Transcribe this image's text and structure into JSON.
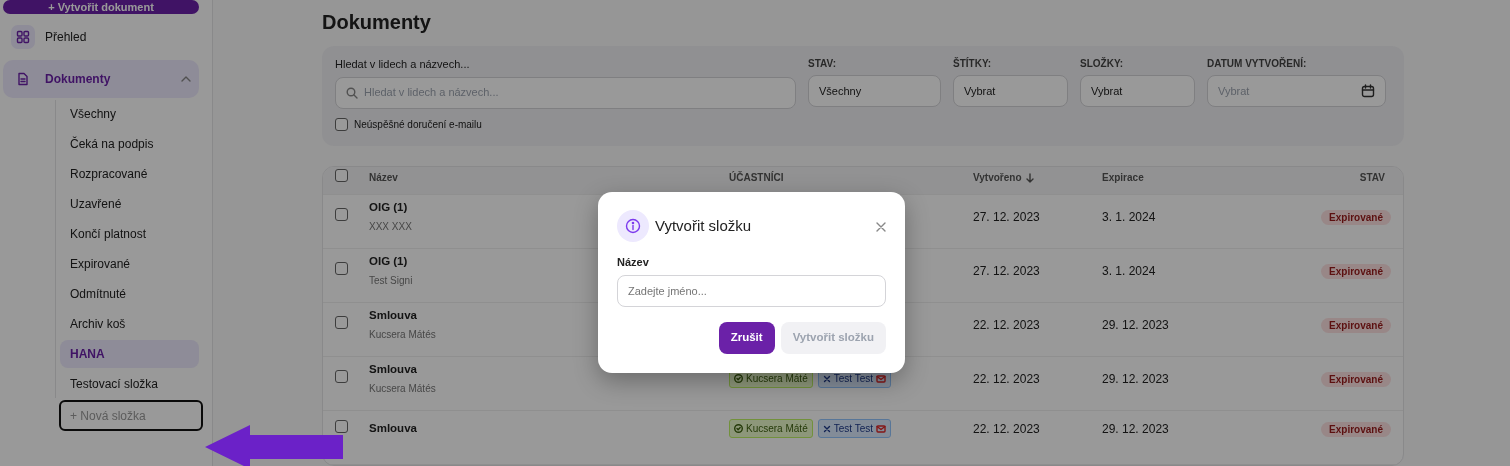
{
  "sidebar": {
    "create_button": "+ Vytvořit dokument",
    "items": [
      {
        "label": "Přehled",
        "selected": false
      },
      {
        "label": "Dokumenty",
        "selected": true,
        "expanded": true,
        "children": [
          {
            "label": "Všechny",
            "selected": false
          },
          {
            "label": "Čeká na podpis",
            "selected": false
          },
          {
            "label": "Rozpracované",
            "selected": false
          },
          {
            "label": "Uzavřené",
            "selected": false
          },
          {
            "label": "Končí platnost",
            "selected": false
          },
          {
            "label": "Expirované",
            "selected": false
          },
          {
            "label": "Odmítnuté",
            "selected": false
          },
          {
            "label": "Archiv koš",
            "selected": false
          },
          {
            "label": "HANA",
            "selected": true
          },
          {
            "label": "Testovací složka",
            "selected": false
          }
        ]
      }
    ],
    "new_folder": "+ Nová složka"
  },
  "page_title": "Dokumenty",
  "filters": {
    "search": {
      "label": "Hledat v lidech a názvech...",
      "placeholder": "Hledat v lidech a názvech..."
    },
    "selects": [
      {
        "label": "STAV:",
        "value": "Všechny",
        "kind": "select"
      },
      {
        "label": "ŠTÍTKY:",
        "value": "Vybrat",
        "kind": "select"
      },
      {
        "label": "SLOŽKY:",
        "value": "Vybrat",
        "kind": "select"
      },
      {
        "label": "DATUM VYTVOŘENÍ:",
        "placeholder": "Vybrat",
        "kind": "date"
      }
    ],
    "failed_email": {
      "label": "Neúspěšné doručení e-mailu",
      "checked": false
    }
  },
  "table": {
    "all_checked": false,
    "columns": [
      {
        "label": "Název",
        "sorted": false
      },
      {
        "label": "ÚČASTNÍCI",
        "sorted": false
      },
      {
        "label": "Vytvořeno",
        "sorted": true
      },
      {
        "label": "Expirace",
        "sorted": false
      },
      {
        "label": "STAV",
        "sorted": false
      }
    ],
    "rows": [
      {
        "checked": false,
        "name": "OIG (1)",
        "subtitle": "XXX XXX",
        "participants": [],
        "created": "27. 12. 2023",
        "expires": "3. 1. 2024",
        "status": "Expirované"
      },
      {
        "checked": false,
        "name": "OIG (1)",
        "subtitle": "Test Signi",
        "participants": [],
        "created": "27. 12. 2023",
        "expires": "3. 1. 2024",
        "status": "Expirované"
      },
      {
        "checked": false,
        "name": "Smlouva",
        "subtitle": "Kucsera Mátés",
        "participants": [],
        "created": "22. 12. 2023",
        "expires": "29. 12. 2023",
        "status": "Expirované"
      },
      {
        "checked": false,
        "name": "Smlouva",
        "subtitle": "Kucsera Mátés",
        "participants": [
          {
            "name": "Kucsera Máté",
            "kind": "signed"
          },
          {
            "name": "Test Test",
            "kind": "email_failed"
          }
        ],
        "created": "22. 12. 2023",
        "expires": "29. 12. 2023",
        "status": "Expirované"
      },
      {
        "checked": false,
        "name": "Smlouva",
        "participants": [
          {
            "name": "Kucsera Máté",
            "kind": "signed"
          },
          {
            "name": "Test Test",
            "kind": "email_failed"
          }
        ],
        "created": "22. 12. 2023",
        "expires": "29. 12. 2023",
        "status": "Expirované"
      }
    ]
  },
  "modal": {
    "title": "Vytvořit složku",
    "field_label": "Název",
    "placeholder": "Zadejte jméno...",
    "buttons": [
      {
        "label": "Zrušit",
        "disabled": false
      },
      {
        "label": "Vytvořit složku",
        "disabled": true
      }
    ]
  }
}
